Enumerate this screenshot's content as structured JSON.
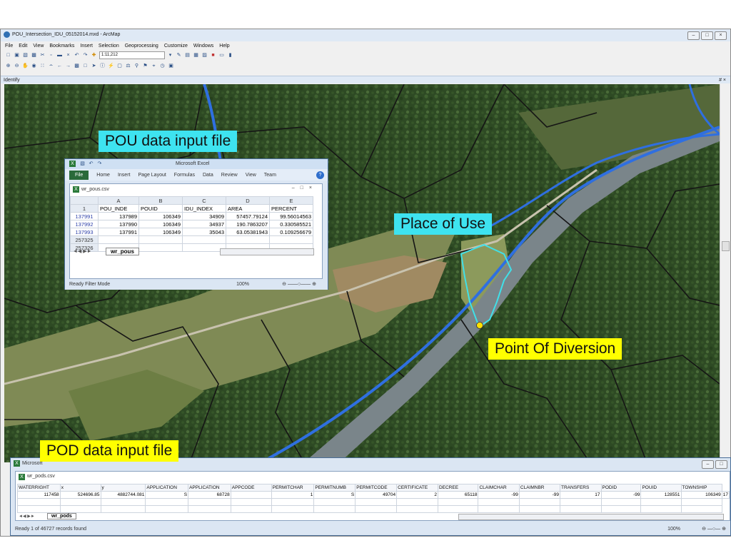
{
  "arcmap": {
    "title": "POU_Intersection_IDU_05152014.mxd - ArcMap",
    "menu": [
      "File",
      "Edit",
      "View",
      "Bookmarks",
      "Insert",
      "Selection",
      "Geoprocessing",
      "Customize",
      "Windows",
      "Help"
    ],
    "scale": "1:11,212",
    "identify_title": "Identify",
    "identify_pin": " # ×"
  },
  "callouts": {
    "pou_file": "POU data input file",
    "place_of_use": "Place of Use",
    "point_of_diversion": "Point Of Diversion",
    "pod_file": "POD data input file"
  },
  "excel_pous": {
    "app_title": "Microsoft Excel",
    "ribbon": [
      "File",
      "Home",
      "Insert",
      "Page Layout",
      "Formulas",
      "Data",
      "Review",
      "View",
      "Team"
    ],
    "file_name": "wr_pous.csv",
    "column_letters": [
      "A",
      "B",
      "C",
      "D",
      "E"
    ],
    "headers": [
      "POU_INDE",
      "POUID",
      "IDU_INDEX",
      "AREA",
      "PERCENT"
    ],
    "header_row_num": "1",
    "rows": [
      {
        "num": "137991",
        "cells": [
          "137989",
          "106349",
          "34909",
          "57457.79124",
          "99.56014563"
        ]
      },
      {
        "num": "137992",
        "cells": [
          "137990",
          "106349",
          "34937",
          "190.7863207",
          "0.330585521"
        ]
      },
      {
        "num": "137993",
        "cells": [
          "137991",
          "106349",
          "35043",
          "63.05381943",
          "0.109256679"
        ]
      },
      {
        "num": "257325",
        "cells": [
          "",
          "",
          "",
          "",
          ""
        ]
      },
      {
        "num": "257326",
        "cells": [
          "",
          "",
          "",
          "",
          ""
        ]
      }
    ],
    "sheet_tab": "wr_pous",
    "status": "Ready   Filter Mode",
    "zoom": "100%"
  },
  "excel_pods": {
    "app_title": "Microsoft",
    "file_name": "wr_pods.csv",
    "headers": [
      "WATERRIGHT",
      "x",
      "y",
      "APPLICATION",
      "APPLICATION",
      "APPCODE",
      "PERMITCHAR",
      "PERMITNUMB",
      "PERMITCODE",
      "CERTIFICATE",
      "DECREE",
      "CLAIMCHAR",
      "CLAIMNBR",
      "TRANSFERS",
      "PODID",
      "POUID",
      "TOWNSHIP"
    ],
    "row": [
      "117458",
      "524696.85",
      "4882744.081",
      "S",
      "68728",
      "",
      "1",
      "S",
      "49704",
      "2",
      "65118",
      "-99",
      "-99",
      "17",
      "-99",
      "128551",
      "106349",
      "17"
    ],
    "sheet_tab": "wr_pods",
    "status": "Ready   1 of 46727 records found",
    "zoom": "100%"
  },
  "colors": {
    "callout_cyan": "#3ee3f0",
    "callout_yellow": "#ffff00",
    "river_blue": "#2f6fe0",
    "parcel_outline": "#1a1a1a",
    "pou_polygon": "#40e0e8",
    "pod_point": "#ffe000"
  }
}
